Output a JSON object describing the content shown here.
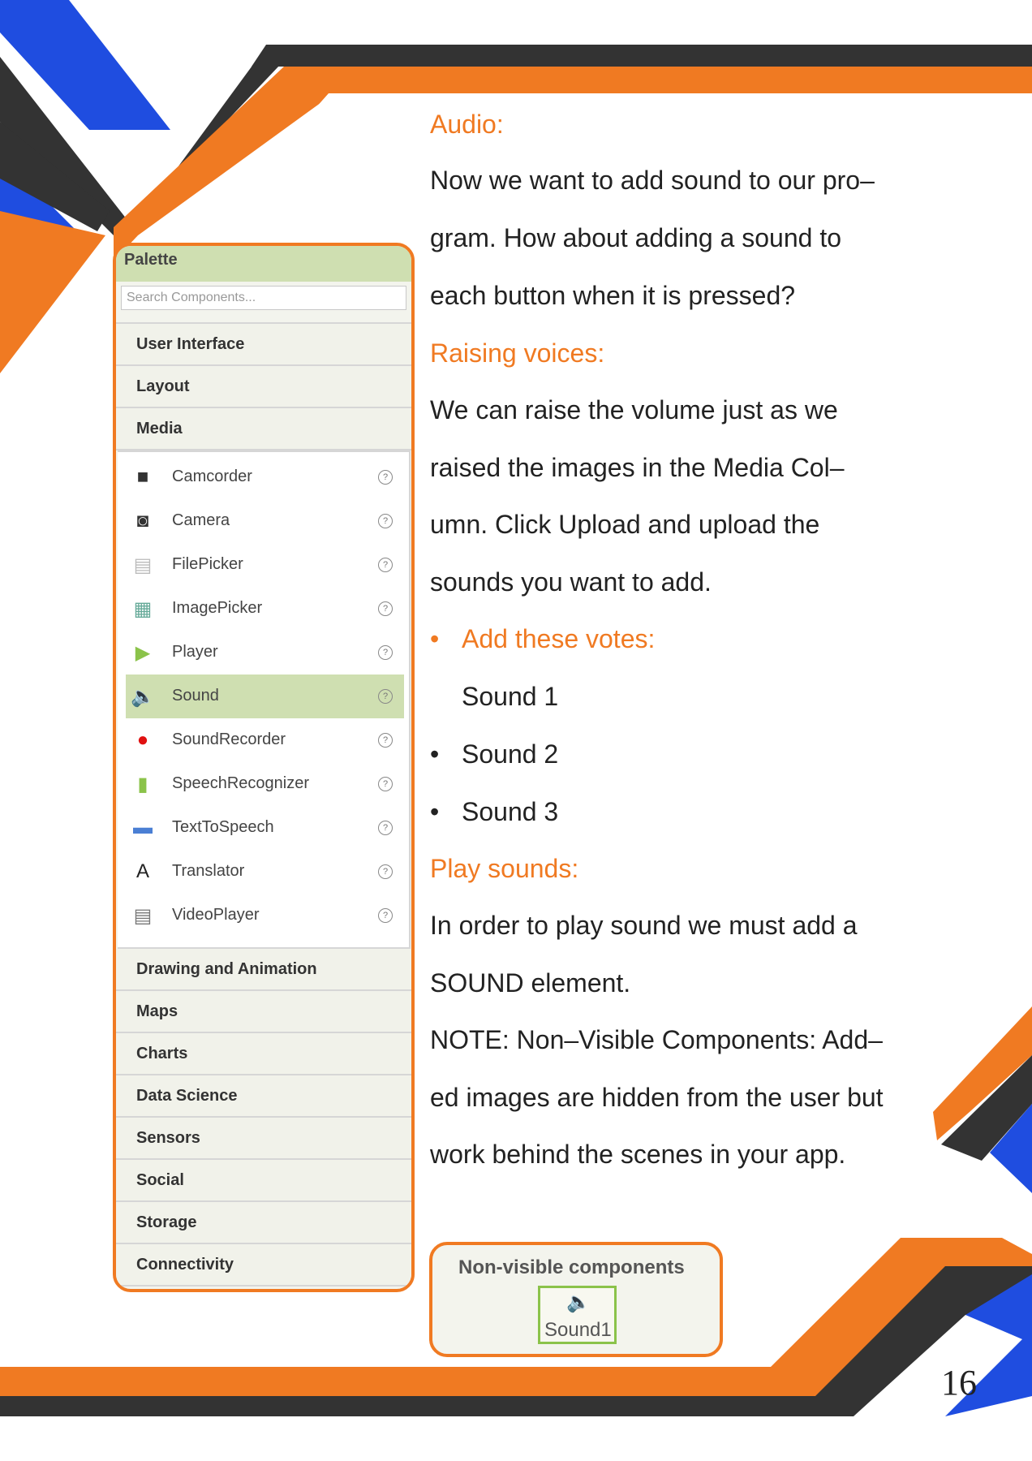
{
  "palette": {
    "title": "Palette",
    "search_placeholder": "Search Components...",
    "categories_top": [
      "User Interface",
      "Layout",
      "Media"
    ],
    "media_items": [
      {
        "label": "Camcorder",
        "icon": "camcorder-icon",
        "selected": false
      },
      {
        "label": "Camera",
        "icon": "camera-icon",
        "selected": false
      },
      {
        "label": "FilePicker",
        "icon": "file-icon",
        "selected": false
      },
      {
        "label": "ImagePicker",
        "icon": "image-icon",
        "selected": false
      },
      {
        "label": "Player",
        "icon": "play-icon",
        "selected": false
      },
      {
        "label": "Sound",
        "icon": "speaker-icon",
        "selected": true
      },
      {
        "label": "SoundRecorder",
        "icon": "record-icon",
        "selected": false
      },
      {
        "label": "SpeechRecognizer",
        "icon": "microphone-icon",
        "selected": false
      },
      {
        "label": "TextToSpeech",
        "icon": "speech-bubble-icon",
        "selected": false
      },
      {
        "label": "Translator",
        "icon": "translator-icon",
        "selected": false
      },
      {
        "label": "VideoPlayer",
        "icon": "clapperboard-icon",
        "selected": false
      }
    ],
    "help_glyph": "?",
    "categories_bottom": [
      "Drawing and Animation",
      "Maps",
      "Charts",
      "Data Science",
      "Sensors",
      "Social",
      "Storage",
      "Connectivity"
    ]
  },
  "content": {
    "h_audio": "Audio:",
    "audio_lines": [
      "Now we want to add sound to our pro–",
      "gram. How about adding a sound to",
      "each button when it is pressed?"
    ],
    "h_raising": "Raising voices:",
    "raising_lines": [
      "We can raise the volume just as we",
      "raised the images in the Media Col–",
      "umn. Click Upload and upload the",
      "sounds you want to add."
    ],
    "h_add": "Add these votes:",
    "sounds": [
      "Sound 1",
      "Sound 2",
      "Sound 3"
    ],
    "h_play": "Play sounds:",
    "play_lines": [
      "In order to play sound we must add a",
      "SOUND element.",
      "NOTE: Non–Visible Components: Add–",
      "ed images are hidden from the user but",
      "work behind the scenes in your app."
    ]
  },
  "nonvisible": {
    "title": "Non-visible components",
    "item_label": "Sound1",
    "item_icon": "speaker-icon"
  },
  "page_number": "16",
  "colors": {
    "orange": "#f07a22",
    "blue": "#1f4de0",
    "dark": "#333333",
    "green_header": "#cfdfb1"
  }
}
